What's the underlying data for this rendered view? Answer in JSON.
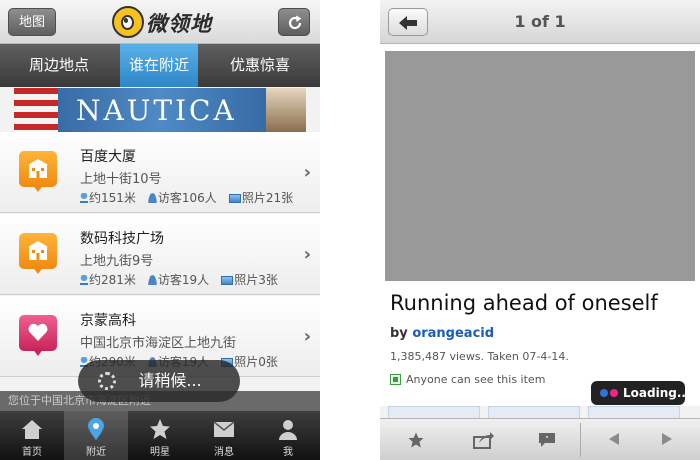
{
  "left_app": {
    "header": {
      "map_button": "地图",
      "logo_text": "微领地"
    },
    "tabs": [
      {
        "label": "周边地点",
        "active": false
      },
      {
        "label": "谁在附近",
        "active": true
      },
      {
        "label": "优惠惊喜",
        "active": false
      }
    ],
    "banner": {
      "brand": "NAUTICA"
    },
    "places": [
      {
        "name": "百度大厦",
        "address": "上地十街10号",
        "distance": "约151米",
        "visitors": "访客106人",
        "photos": "照片21张",
        "icon_color": "orange",
        "icon": "building-icon"
      },
      {
        "name": "数码科技广场",
        "address": "上地九街9号",
        "distance": "约281米",
        "visitors": "访客19人",
        "photos": "照片3张",
        "icon_color": "orange",
        "icon": "building-icon"
      },
      {
        "name": "京蒙高科",
        "address": "中国北京市海淀区上地九街",
        "distance": "约290米",
        "visitors": "访客19人",
        "photos": "照片0张",
        "icon_color": "pink",
        "icon": "heart-icon"
      }
    ],
    "loading_text": "请稍候...",
    "location_text": "您位于中国北京市海淀区附近",
    "tabbar": [
      {
        "label": "首页",
        "icon": "home-icon",
        "active": false
      },
      {
        "label": "附近",
        "icon": "location-pin-icon",
        "active": true
      },
      {
        "label": "明星",
        "icon": "star-icon",
        "active": false
      },
      {
        "label": "消息",
        "icon": "mail-icon",
        "active": false
      },
      {
        "label": "我",
        "icon": "person-icon",
        "active": false
      }
    ],
    "colors": {
      "active_tab": "#2f86c8",
      "pin_orange": "#f08a10",
      "pin_pink": "#c9245a"
    }
  },
  "right_app": {
    "header": {
      "counter": "1 of 1"
    },
    "photo": {
      "title": "Running ahead of oneself",
      "by_label": "by",
      "author": "orangeacid",
      "stats": "1,385,487 views. Taken 07-4-14.",
      "privacy": "Anyone can see this item"
    },
    "loading_text": "Loading...",
    "toolbar": [
      "star-icon",
      "share-icon",
      "comment-icon",
      "prev-arrow-icon",
      "next-arrow-icon"
    ],
    "colors": {
      "author_link": "#1a5db5",
      "flickr_blue": "#2f73d8",
      "flickr_pink": "#f1248d"
    }
  }
}
